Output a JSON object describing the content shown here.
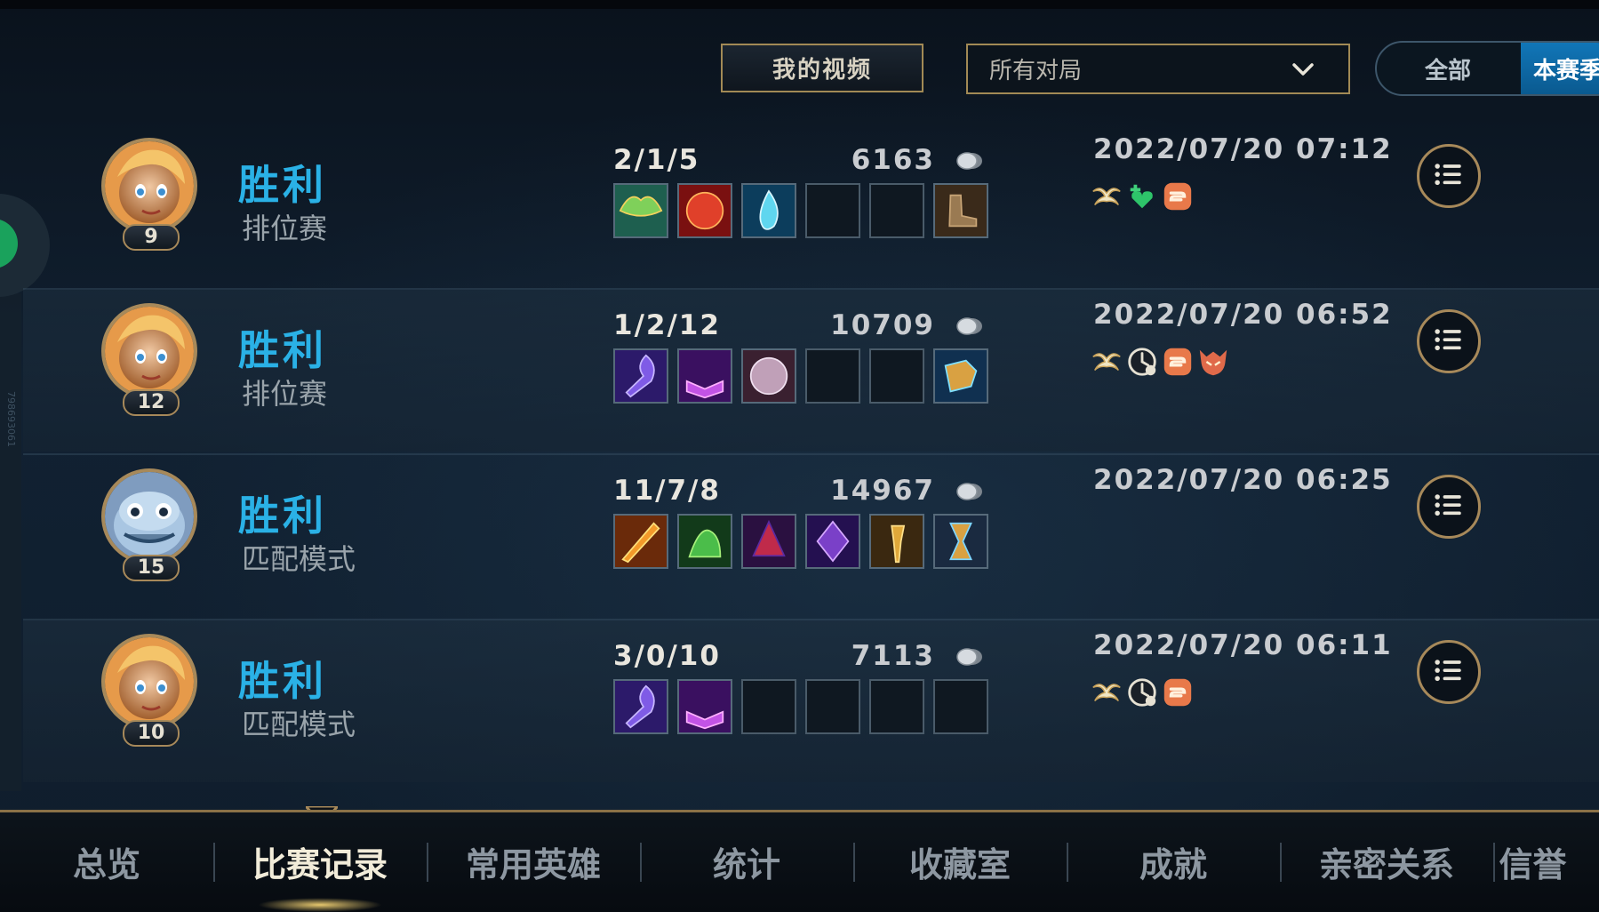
{
  "toolbar": {
    "my_videos_label": "我的视频",
    "filter_value": "所有对局",
    "toggle_all": "全部",
    "toggle_season": "本赛季"
  },
  "side": {
    "watermark": "798693061"
  },
  "matches": [
    {
      "result": "胜利",
      "mode": "排位赛",
      "level": "9",
      "champion": "lux",
      "kda": "2/1/5",
      "gold": "6163",
      "date": "2022/07/20 07:12",
      "items": [
        "sprout-item",
        "red-orb-item",
        "tear-item",
        "empty",
        "empty",
        "boots-item"
      ],
      "badges": [
        "wings-badge",
        "heal-badge",
        "chain-badge"
      ]
    },
    {
      "result": "胜利",
      "mode": "排位赛",
      "level": "12",
      "champion": "lux",
      "kda": "1/2/12",
      "gold": "10709",
      "date": "2022/07/20 06:52",
      "items": [
        "purple-staff-item",
        "purple-tome-item",
        "compass-item",
        "empty",
        "empty",
        "jet-boots-item"
      ],
      "badges": [
        "wings-badge",
        "cooldown-badge",
        "chain-badge",
        "demon-badge"
      ]
    },
    {
      "result": "胜利",
      "mode": "匹配模式",
      "level": "15",
      "champion": "fizz",
      "kda": "11/7/8",
      "gold": "14967",
      "date": "2022/07/20 06:25",
      "items": [
        "flame-blade-item",
        "green-claw-item",
        "witch-hat-item",
        "void-crystal-item",
        "golden-mace-item",
        "hourglass-item"
      ],
      "badges": []
    },
    {
      "result": "胜利",
      "mode": "匹配模式",
      "level": "10",
      "champion": "lux",
      "kda": "3/0/10",
      "gold": "7113",
      "date": "2022/07/20 06:11",
      "items": [
        "purple-staff-item",
        "purple-tome-item",
        "empty",
        "empty",
        "empty",
        "empty"
      ],
      "badges": [
        "wings-badge",
        "cooldown-badge",
        "chain-badge"
      ]
    }
  ],
  "tabs": [
    "总览",
    "比赛记录",
    "常用英雄",
    "统计",
    "收藏室",
    "成就",
    "亲密关系",
    "信誉"
  ],
  "active_tab": "比赛记录",
  "colors": {
    "victory": "#2ab1e6",
    "gold_border": "#a28a55",
    "toggle_active": "#1176b8",
    "background": "#0c1723"
  }
}
